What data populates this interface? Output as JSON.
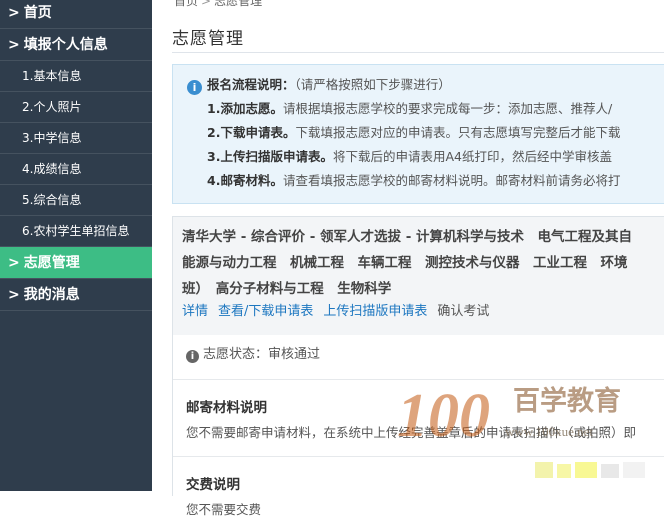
{
  "sidebar": {
    "items": [
      {
        "label": "首页",
        "arrow": ">"
      },
      {
        "label": "填报个人信息",
        "arrow": ">"
      },
      {
        "label": "1.基本信息"
      },
      {
        "label": "2.个人照片"
      },
      {
        "label": "3.中学信息"
      },
      {
        "label": "4.成绩信息"
      },
      {
        "label": "5.综合信息"
      },
      {
        "label": "6.农村学生单招信息"
      },
      {
        "label": "志愿管理",
        "arrow": ">"
      },
      {
        "label": "我的消息",
        "arrow": ">"
      }
    ],
    "bg_color": "#2f3d4c",
    "active_color": "#3dbd85"
  },
  "breadcrumb": {
    "home": "首页",
    "sep": ">",
    "current": "志愿管理"
  },
  "page_title": "志愿管理",
  "notice": {
    "lead": "报名流程说明：",
    "hint": "（请严格按照如下步骤进行）",
    "steps": [
      {
        "title": "1.添加志愿。",
        "text": "请根据填报志愿学校的要求完成每一步：添加志愿、推荐人/"
      },
      {
        "title": "2.下载申请表。",
        "text": "下载填报志愿对应的申请表。只有志愿填写完整后才能下载"
      },
      {
        "title": "3.上传扫描版申请表。",
        "text": "将下载后的申请表用A4纸打印，然后经中学审核盖"
      },
      {
        "title": "4.邮寄材料。",
        "text": "请查看填报志愿学校的邮寄材料说明。邮寄材料前请务必将打"
      }
    ]
  },
  "application": {
    "head_lines": [
      "清华大学 - 综合评价 - 领军人才选拔 - 计算机科学与技术　电气工程及其自",
      "能源与动力工程　机械工程　车辆工程　测控技术与仪器　工业工程　环境",
      "班）　高分子材料与工程　生物科学"
    ],
    "links": {
      "detail": "详情",
      "download": "查看/下载申请表",
      "upload": "上传扫描版申请表",
      "confirm": "确认考试"
    },
    "status_label": "志愿状态：",
    "status_value": "审核通过",
    "mail_title": "邮寄材料说明",
    "mail_text": "您不需要邮寄申请材料，在系统中上传经完善盖章后的申请表扫描件（或拍照）即",
    "fee_title": "交费说明",
    "fee_text": "您不需要交费"
  },
  "watermark": {
    "brand": "百学教育",
    "url": "www.100xue.net",
    "num": "100"
  }
}
